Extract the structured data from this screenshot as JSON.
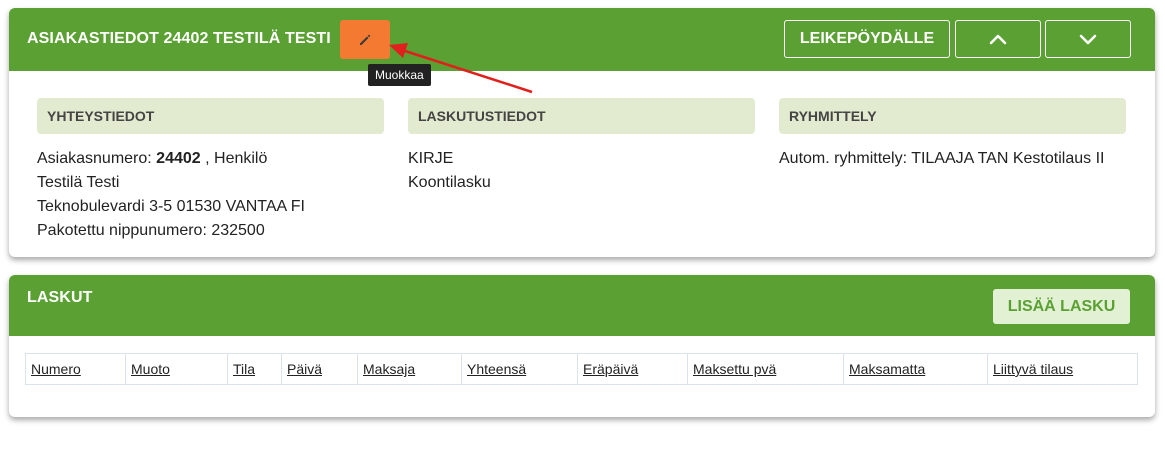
{
  "customer_panel": {
    "title": "ASIAKASTIEDOT 24402 TESTILÄ TESTI",
    "edit_tooltip": "Muokkaa",
    "clipboard_label": "LEIKEPÖYDÄLLE",
    "sections": {
      "contact": {
        "heading": "YHTEYSTIEDOT",
        "customer_no_label": "Asiakasnumero: ",
        "customer_no": "24402",
        "customer_type": " , Henkilö",
        "name": "Testilä Testi",
        "address": "Teknobulevardi 3-5 01530 VANTAA FI",
        "forced_bundle": "Pakotettu nippunumero: 232500"
      },
      "billing": {
        "heading": "LASKUTUSTIEDOT",
        "delivery": "KIRJE",
        "invoice_type": "Koontilasku"
      },
      "grouping": {
        "heading": "RYHMITTELY",
        "auto_grouping": "Autom. ryhmittely: TILAAJA TAN Kestotilaus II"
      }
    }
  },
  "invoices_panel": {
    "title": "LASKUT",
    "add_label": "LISÄÄ LASKU",
    "columns": [
      "Numero",
      "Muoto",
      "Tila",
      "Päivä",
      "Maksaja",
      "Yhteensä",
      "Eräpäivä",
      "Maksettu pvä",
      "Maksamatta",
      "Liittyvä tilaus"
    ]
  },
  "colors": {
    "header_green": "#5ba033",
    "edit_orange": "#f47a31",
    "section_bg": "#e2ebcf",
    "annotation_arrow": "#e0201c"
  },
  "icons": {
    "edit": "pencil-icon",
    "up": "chevron-up-icon",
    "down": "chevron-down-icon"
  }
}
